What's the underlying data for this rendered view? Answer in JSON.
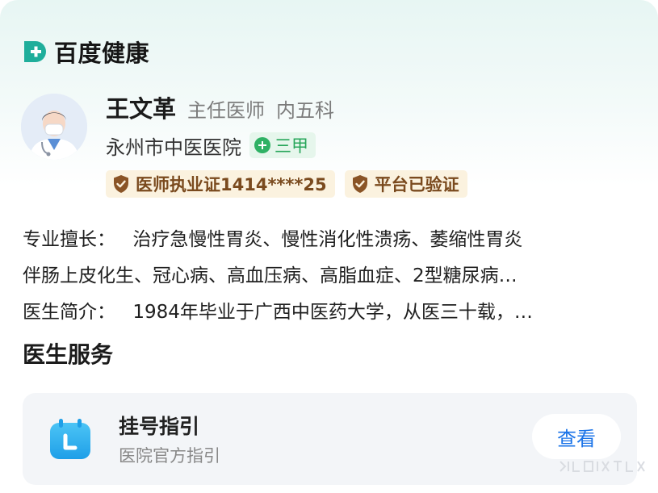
{
  "brand": {
    "name": "百度健康",
    "logo_icon": "baidu-health-d-plus-icon"
  },
  "doctor": {
    "name": "王文革",
    "title": "主任医师",
    "department": "内五科",
    "hospital": "永州市中医医院",
    "grade": "三甲",
    "license": "医师执业证1414****25",
    "verified": "平台已验证",
    "avatar_icon": "doctor-avatar-icon"
  },
  "info": {
    "specialty_label": "专业擅长：",
    "specialty_line1": "治疗急慢性胃炎、慢性消化性溃疡、萎缩性胃炎",
    "specialty_line2": "伴肠上皮化生、冠心病、高血压病、高脂血症、2型糖尿病…",
    "intro_label": "医生简介：",
    "intro_text": "1984年毕业于广西中医药大学，从医三十载，…"
  },
  "services": {
    "section_title": "医生服务",
    "items": [
      {
        "title": "挂号指引",
        "subtitle": "医院官方指引",
        "button": "查看",
        "icon": "calendar-icon"
      }
    ]
  },
  "colors": {
    "accent_blue": "#1a73e8",
    "grade_green": "#27a65a",
    "cert_brown": "#7a4a1e",
    "brand_teal": "#1fae9b"
  }
}
